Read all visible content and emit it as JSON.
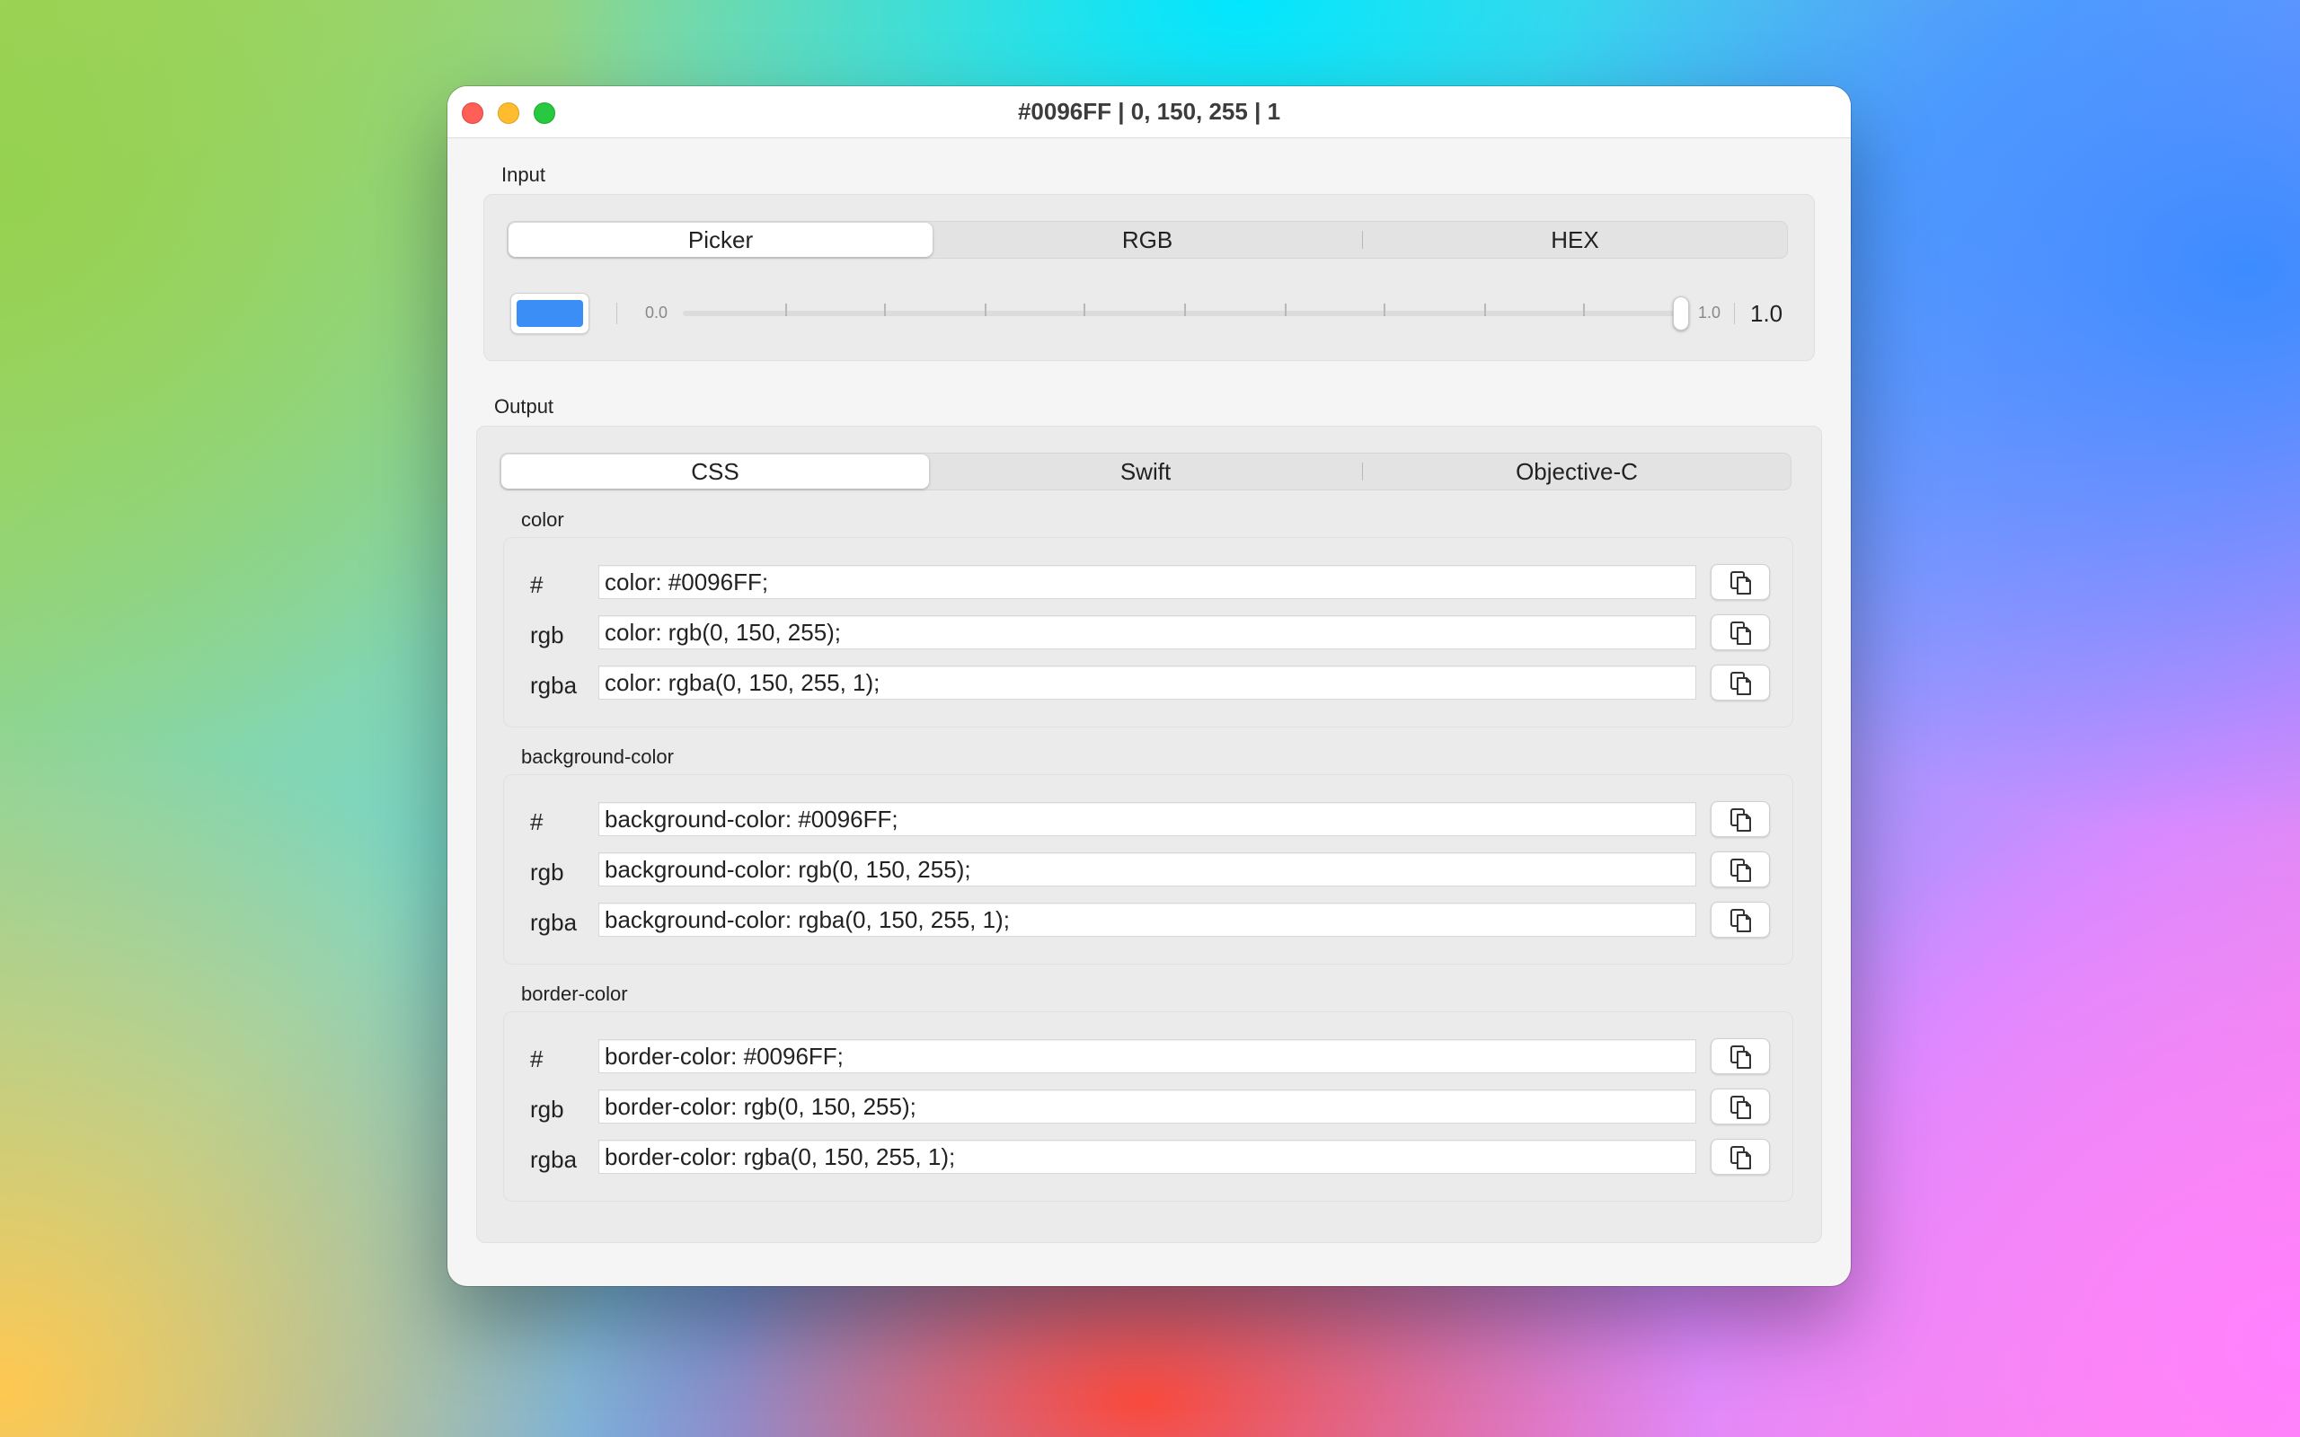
{
  "window": {
    "title": "#0096FF | 0, 150, 255 | 1"
  },
  "input": {
    "label": "Input",
    "tabs": [
      "Picker",
      "RGB",
      "HEX"
    ],
    "selected_tab": "Picker",
    "swatch_color": "#3a8ef6",
    "slider": {
      "min_label": "0.0",
      "max_label": "1.0",
      "value": 1.0,
      "value_label": "1.0"
    }
  },
  "output": {
    "label": "Output",
    "tabs": [
      "CSS",
      "Swift",
      "Objective-C"
    ],
    "selected_tab": "CSS",
    "groups": [
      {
        "name": "color",
        "rows": [
          {
            "key": "#",
            "value": "color: #0096FF;"
          },
          {
            "key": "rgb",
            "value": "color: rgb(0, 150, 255);"
          },
          {
            "key": "rgba",
            "value": "color: rgba(0, 150, 255, 1);"
          }
        ]
      },
      {
        "name": "background-color",
        "rows": [
          {
            "key": "#",
            "value": "background-color: #0096FF;"
          },
          {
            "key": "rgb",
            "value": "background-color: rgb(0, 150, 255);"
          },
          {
            "key": "rgba",
            "value": "background-color: rgba(0, 150, 255, 1);"
          }
        ]
      },
      {
        "name": "border-color",
        "rows": [
          {
            "key": "#",
            "value": "border-color: #0096FF;"
          },
          {
            "key": "rgb",
            "value": "border-color: rgb(0, 150, 255);"
          },
          {
            "key": "rgba",
            "value": "border-color: rgba(0, 150, 255, 1);"
          }
        ]
      }
    ]
  },
  "icons": {
    "copy": "copy-icon"
  }
}
